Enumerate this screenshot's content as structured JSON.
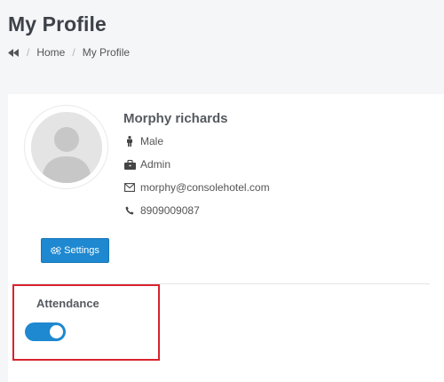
{
  "header": {
    "title": "My Profile",
    "breadcrumb": {
      "back_icon": "double-chevron-left-icon",
      "separator": "/",
      "home": "Home",
      "current": "My Profile"
    }
  },
  "profile": {
    "avatar_icon": "user-avatar-placeholder",
    "name": "Morphy richards",
    "gender": {
      "icon": "male-icon",
      "value": "Male"
    },
    "role": {
      "icon": "briefcase-icon",
      "value": "Admin"
    },
    "email": {
      "icon": "envelope-icon",
      "value": "morphy@consolehotel.com"
    },
    "phone": {
      "icon": "phone-icon",
      "value": "8909009087"
    },
    "settings_button": {
      "icon": "cogs-icon",
      "label": "Settings"
    }
  },
  "attendance": {
    "label": "Attendance",
    "toggle_on": true
  },
  "colors": {
    "accent": "#1e88d0",
    "highlight": "#d9232e",
    "title_text": "#3d4148"
  }
}
